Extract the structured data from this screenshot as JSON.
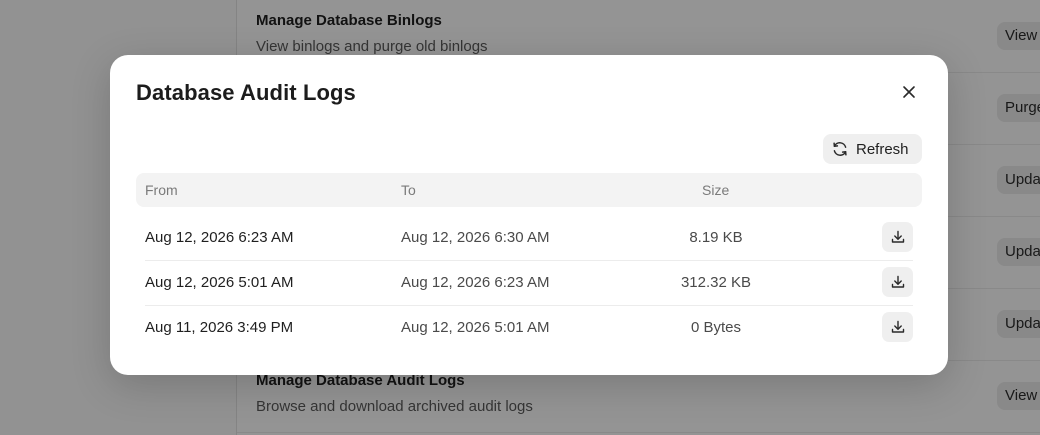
{
  "background": {
    "rows": [
      {
        "title": "Manage Database Binlogs",
        "description": "View binlogs and purge old binlogs",
        "button": "View"
      },
      {
        "title": "",
        "description": "",
        "button": "Purge"
      },
      {
        "title": "",
        "description": "",
        "button": "Update"
      },
      {
        "title": "",
        "description": "",
        "button": "Update"
      },
      {
        "title": "",
        "description": "",
        "button": "Update"
      },
      {
        "title": "Manage Database Audit Logs",
        "description": "Browse and download archived audit logs",
        "button": "View"
      }
    ]
  },
  "modal": {
    "title": "Database Audit Logs",
    "close_icon": "close-icon",
    "refresh": {
      "label": "Refresh",
      "icon": "refresh-icon"
    },
    "table": {
      "headers": {
        "from": "From",
        "to": "To",
        "size": "Size"
      },
      "rows": [
        {
          "from": "Aug 12, 2026 6:23 AM",
          "to": "Aug 12, 2026 6:30 AM",
          "size": "8.19 KB"
        },
        {
          "from": "Aug 12, 2026 5:01 AM",
          "to": "Aug 12, 2026 6:23 AM",
          "size": "312.32 KB"
        },
        {
          "from": "Aug 11, 2026 3:49 PM",
          "to": "Aug 12, 2026 5:01 AM",
          "size": "0 Bytes"
        }
      ],
      "download_icon": "download-icon"
    }
  },
  "colors": {
    "overlay": "#00000069",
    "modal_bg": "#ffffff",
    "button_bg": "#efefef",
    "header_bg": "#f3f3f3"
  }
}
